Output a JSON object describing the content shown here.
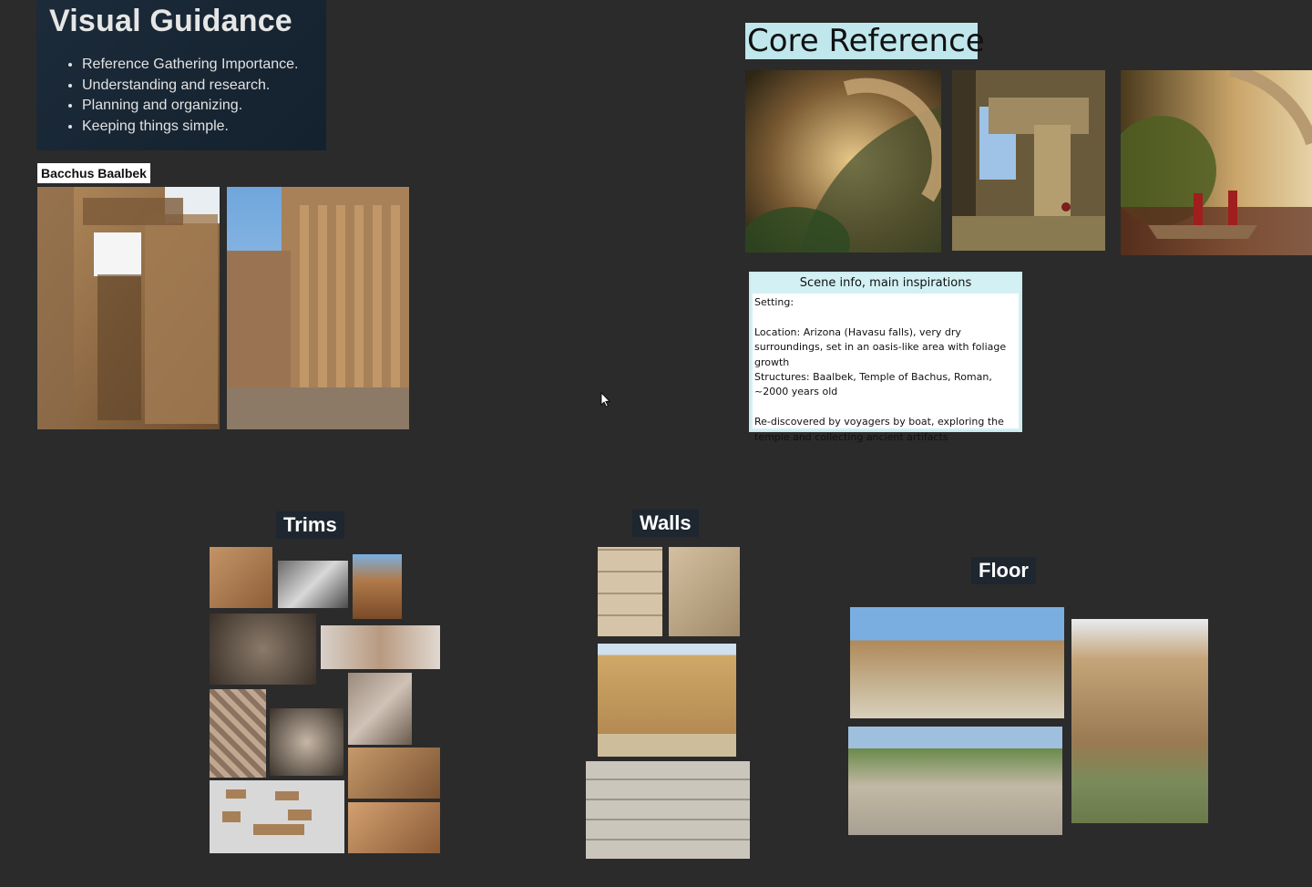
{
  "visual_guidance": {
    "title": "Visual Guidance",
    "bullets": [
      "Reference Gathering Importance.",
      "Understanding and research.",
      "Planning and organizing.",
      "Keeping things simple."
    ]
  },
  "bacchus": {
    "label": "Bacchus Baalbek"
  },
  "core_reference": {
    "title": "Core Reference"
  },
  "scene_info": {
    "header": "Scene info, main inspirations",
    "lines": [
      "Setting:",
      "",
      "Location: Arizona (Havasu falls), very dry surroundings, set in an oasis-like area with foliage growth",
      "Structures: Baalbek, Temple of Bachus, Roman, ~2000 years old",
      "",
      "Re-discovered by voyagers by boat, exploring the temple and collecting ancient artifacts"
    ]
  },
  "sections": {
    "trims": "Trims",
    "walls": "Walls",
    "floor": "Floor"
  },
  "colors": {
    "canvas": "#2b2b2b",
    "card_dark": "#1c2b3a",
    "label_bg": "#1e2630",
    "accent_cyan": "#bfe7ec",
    "scene_header": "#d3f1f4"
  }
}
